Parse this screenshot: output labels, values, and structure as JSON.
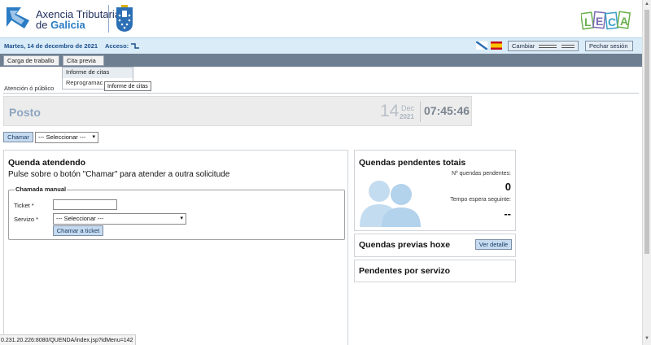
{
  "header": {
    "org_line1": "Axencia Tributaria",
    "org_line2_prefix": "de ",
    "org_line2_bold": "Galicia",
    "brand_color": "#1f2e5c",
    "accent": "#2a7cc4"
  },
  "infobar": {
    "date": "Martes, 14 de decembro de 2021",
    "access_label": "Acceso:",
    "change_label": "Cambiar",
    "logout_label": "Pechar sesión"
  },
  "menu": {
    "items": [
      {
        "label": "Carga de traballo"
      },
      {
        "label": "Cita previa »"
      }
    ],
    "dropdown": [
      {
        "label": "Informe de citas"
      },
      {
        "label": "Reprogramac"
      }
    ],
    "tooltip": "Informe de citas"
  },
  "page": {
    "section_title": "Atención ó público"
  },
  "posto": {
    "label": "Posto",
    "day": "14",
    "month": "Dec",
    "year": "2021",
    "time": "07:45:46"
  },
  "call": {
    "button": "Chamar",
    "select_value": "--- Seleccionar ---"
  },
  "queue": {
    "title": "Quenda atendendo",
    "subtitle": "Pulse sobre o botón \"Chamar\" para atender a outra solicitude",
    "manual": {
      "legend": "Chamada manual",
      "ticket_label": "Ticket *",
      "servizo_label": "Servizo *",
      "servizo_value": "--- Seleccionar ---",
      "button": "Chamar a ticket"
    }
  },
  "pending": {
    "title": "Quendas pendentes totais",
    "count_label": "Nº quendas pendentes:",
    "count_value": "0",
    "wait_label": "Tempo espera seguinte:",
    "wait_value": "--"
  },
  "previas": {
    "title": "Quendas previas hoxe",
    "button": "Ver detalle"
  },
  "by_service": {
    "title": "Pendentes por servizo"
  },
  "statusbar": {
    "url": "0.231.20.226:8080/QUENDA/index.jsp?idMenu=142"
  }
}
